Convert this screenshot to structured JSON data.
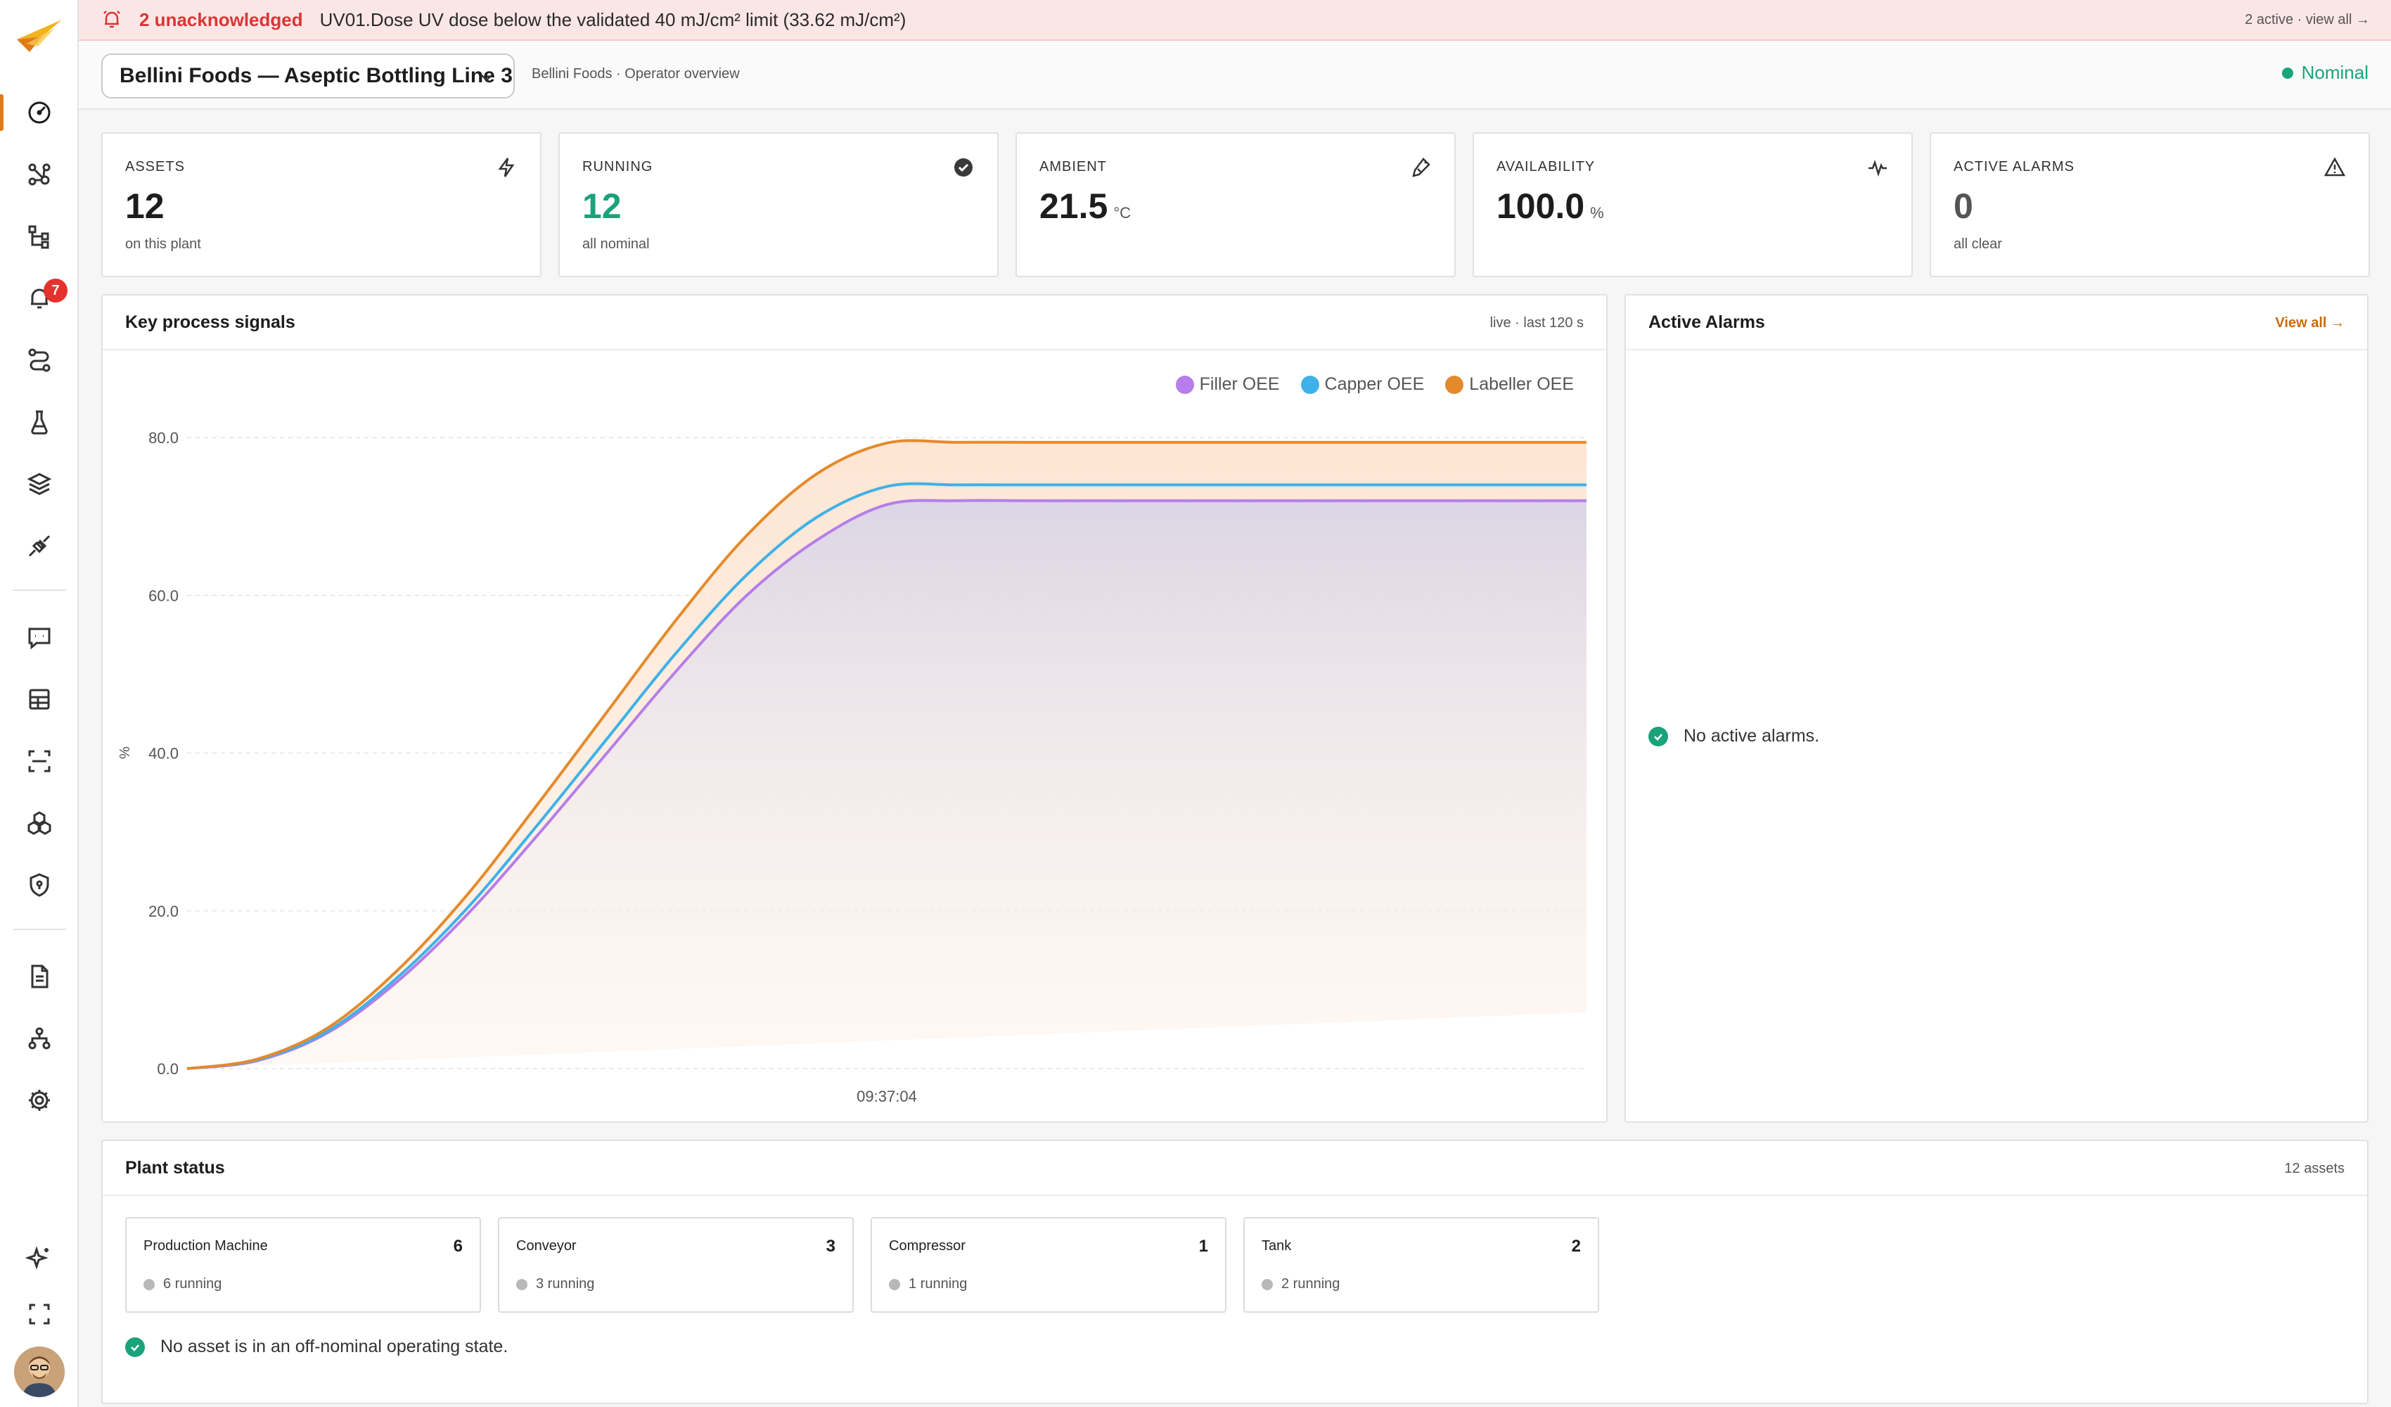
{
  "colors": {
    "accent": "#e07b1a",
    "alarm": "#d93636",
    "nominal": "#1aa37a",
    "filler": "#b57ee8",
    "capper": "#3fb1e8",
    "labeller": "#e58a2c"
  },
  "sidebar": {
    "alarm_badge": "7",
    "items": [
      {
        "icon": "dashboard-gauge-icon",
        "active": true
      },
      {
        "icon": "graph-nodes-icon"
      },
      {
        "icon": "hierarchy-icon"
      },
      {
        "icon": "bell-alarm-icon"
      },
      {
        "icon": "route-icon"
      },
      {
        "icon": "flask-icon"
      },
      {
        "icon": "layers-icon"
      },
      {
        "icon": "plug-icon"
      },
      {
        "icon": "chat-icon"
      },
      {
        "icon": "table-grid-icon"
      },
      {
        "icon": "scan-icon"
      },
      {
        "icon": "cubes-icon"
      },
      {
        "icon": "shield-icon"
      },
      {
        "icon": "document-icon"
      },
      {
        "icon": "org-chart-icon"
      },
      {
        "icon": "gear-icon"
      },
      {
        "icon": "sparkle-icon"
      },
      {
        "icon": "fullscreen-icon"
      }
    ]
  },
  "banner": {
    "unacknowledged": "2 unacknowledged",
    "message": "UV01.Dose UV dose below the validated 40 mJ/cm² limit (33.62 mJ/cm²)",
    "right": "2 active · view all →"
  },
  "header": {
    "plant_selector": "Bellini Foods — Aseptic Bottling Line 3",
    "breadcrumb": "Bellini Foods · Operator overview",
    "status": "Nominal"
  },
  "kpis": [
    {
      "label": "ASSETS",
      "value": "12",
      "unit": "",
      "sub": "on this plant",
      "icon": "bolt-icon"
    },
    {
      "label": "RUNNING",
      "value": "12",
      "unit": "",
      "sub": "all nominal",
      "icon": "check-circle-icon"
    },
    {
      "label": "AMBIENT",
      "value": "21.5",
      "unit": "°C",
      "sub": "",
      "icon": "thermometer-icon"
    },
    {
      "label": "AVAILABILITY",
      "value": "100.0",
      "unit": "%",
      "sub": "",
      "icon": "pulse-icon"
    },
    {
      "label": "ACTIVE ALARMS",
      "value": "0",
      "unit": "",
      "sub": "all clear",
      "icon": "warning-icon"
    }
  ],
  "signals_panel": {
    "title": "Key process signals",
    "meta": "live · last 120 s"
  },
  "chart_data": {
    "type": "area",
    "ylabel": "%",
    "ylim": [
      0,
      80
    ],
    "yticks": [
      "0.0",
      "20.0",
      "40.0",
      "60.0",
      "80.0"
    ],
    "xticks": [
      {
        "label": "09:37:04",
        "t": 0.5
      }
    ],
    "x": [
      0,
      0.05,
      0.1,
      0.15,
      0.2,
      0.25,
      0.3,
      0.35,
      0.4,
      0.45,
      0.5,
      0.55,
      0.6,
      0.65,
      0.7,
      0.75,
      0.8,
      0.85,
      0.9,
      0.95,
      1.0
    ],
    "grid": true,
    "legend": "top-right",
    "series": [
      {
        "name": "Filler OEE",
        "color": "#b57ee8",
        "values": [
          0,
          1.0,
          4.5,
          11,
          19.5,
          29.5,
          40,
          50.5,
          60,
          67,
          71.5,
          72,
          72,
          72,
          72,
          72,
          72,
          72,
          72,
          72,
          72
        ]
      },
      {
        "name": "Capper OEE",
        "color": "#3fb1e8",
        "values": [
          0,
          1.1,
          4.7,
          11.5,
          20.3,
          30.8,
          41.8,
          52.8,
          62.6,
          69.9,
          73.8,
          74,
          74,
          74,
          74,
          74,
          74,
          74,
          74,
          74,
          74
        ]
      },
      {
        "name": "Labeller OEE",
        "color": "#e58a2c",
        "values": [
          0,
          1.2,
          5.1,
          12.4,
          22,
          33.4,
          45.2,
          57,
          67.6,
          75.4,
          79.3,
          79.4,
          79.4,
          79.4,
          79.4,
          79.4,
          79.4,
          79.4,
          79.4,
          79.4,
          79.4
        ]
      }
    ]
  },
  "alarms_panel": {
    "title": "Active Alarms",
    "view_all": "View all →",
    "empty": "No active alarms."
  },
  "plant_status": {
    "title": "Plant status",
    "meta": "12 assets",
    "assets": [
      {
        "name": "Production Machine",
        "count": "6",
        "running": "6 running"
      },
      {
        "name": "Conveyor",
        "count": "3",
        "running": "3 running"
      },
      {
        "name": "Compressor",
        "count": "1",
        "running": "1 running"
      },
      {
        "name": "Tank",
        "count": "2",
        "running": "2 running"
      }
    ],
    "ok_message": "No asset is in an off-nominal operating state."
  }
}
